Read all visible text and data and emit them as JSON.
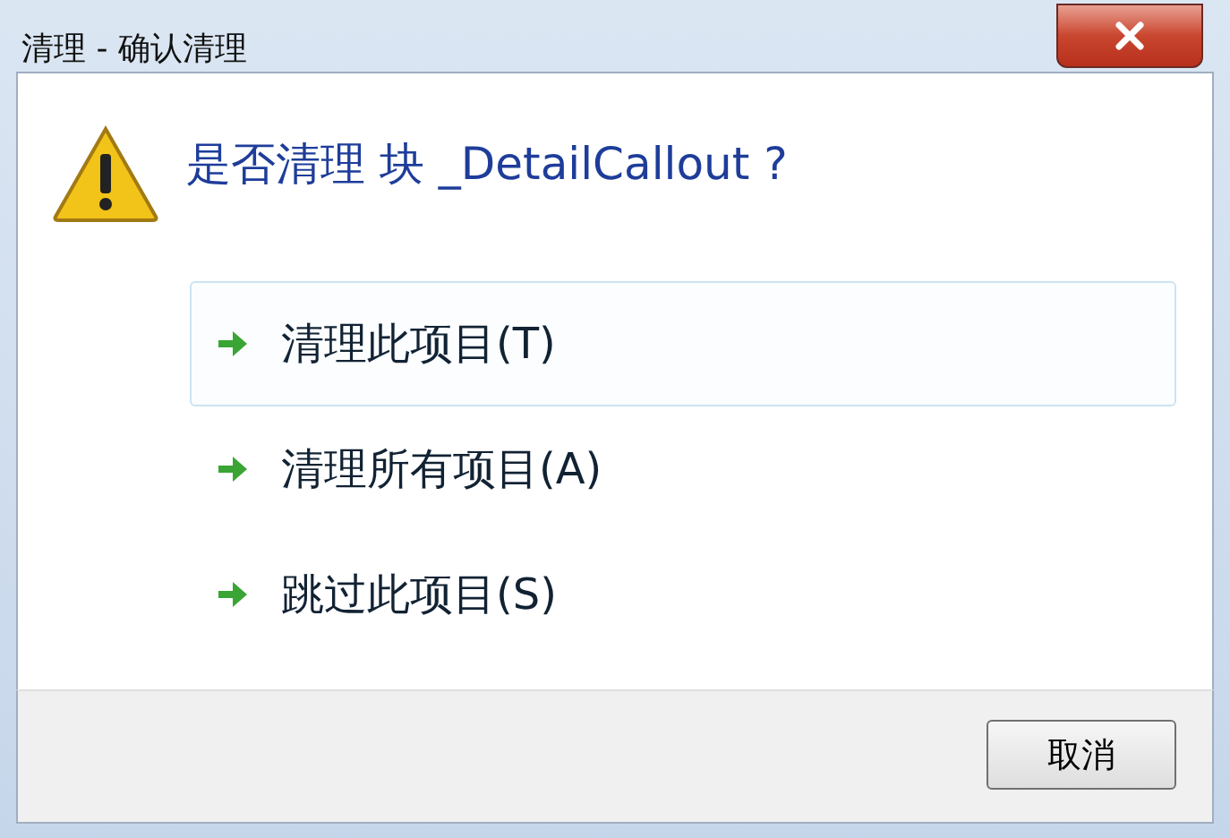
{
  "window": {
    "title": "清理 - 确认清理"
  },
  "message": "是否清理 块 _DetailCallout ?",
  "options": [
    {
      "label": "清理此项目(T)",
      "selected": true
    },
    {
      "label": "清理所有项目(A)",
      "selected": false
    },
    {
      "label": "跳过此项目(S)",
      "selected": false
    }
  ],
  "buttons": [
    "取消"
  ]
}
